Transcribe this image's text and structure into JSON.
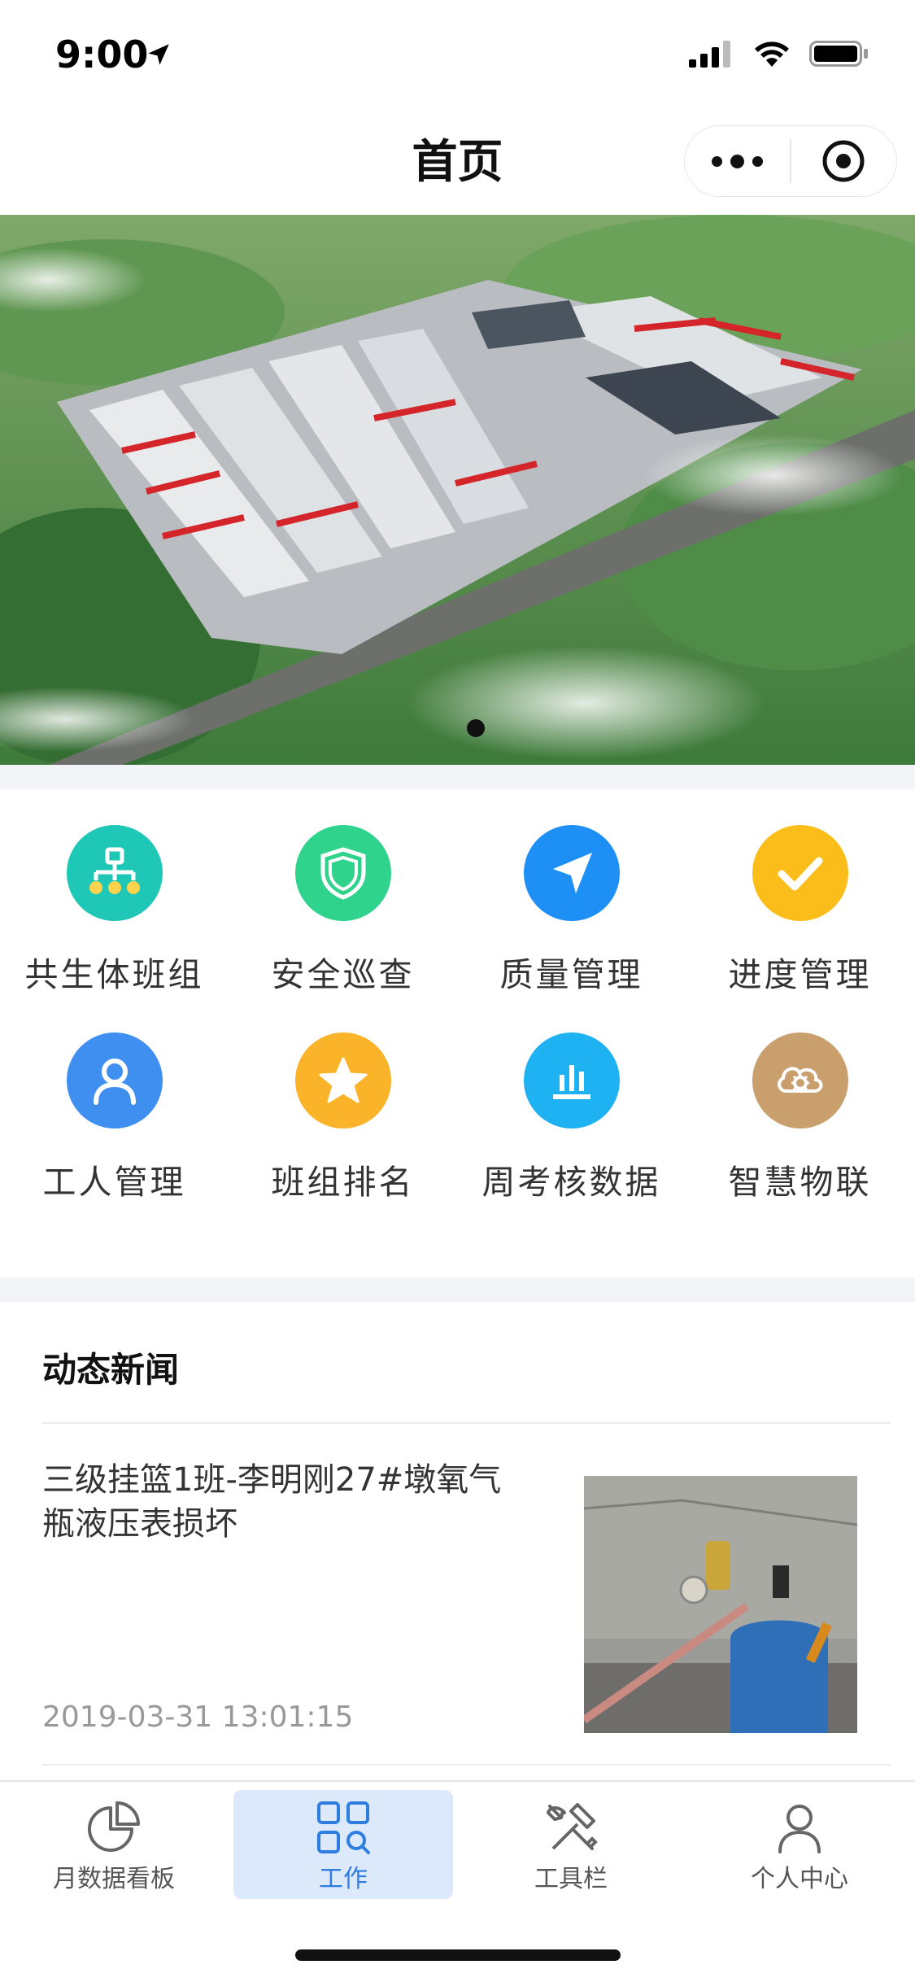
{
  "status_bar": {
    "time": "9:00"
  },
  "nav": {
    "title": "首页"
  },
  "grid": {
    "items": [
      {
        "label": "共生体班组",
        "icon": "org-chart-icon",
        "color": "#1fc7b6"
      },
      {
        "label": "安全巡查",
        "icon": "shield-icon",
        "color": "#2fd38c"
      },
      {
        "label": "质量管理",
        "icon": "send-arrow-icon",
        "color": "#1e8ff5"
      },
      {
        "label": "进度管理",
        "icon": "check-icon",
        "color": "#fbbd1a"
      },
      {
        "label": "工人管理",
        "icon": "person-icon",
        "color": "#3f8ff1"
      },
      {
        "label": "班组排名",
        "icon": "star-icon",
        "color": "#fbb32a"
      },
      {
        "label": "周考核数据",
        "icon": "bar-chart-icon",
        "color": "#1fb2f3"
      },
      {
        "label": "智慧物联",
        "icon": "cloud-gear-icon",
        "color": "#c89f6d"
      }
    ]
  },
  "news": {
    "title": "动态新闻",
    "items": [
      {
        "headline": "三级挂篮1班-李明刚27#墩氧气瓶液压表损坏",
        "time": "2019-03-31 13:01:15"
      }
    ]
  },
  "tabs": [
    {
      "label": "月数据看板",
      "icon": "pie-chart-icon",
      "active": false
    },
    {
      "label": "工作",
      "icon": "work-grid-icon",
      "active": true
    },
    {
      "label": "工具栏",
      "icon": "tools-icon",
      "active": false
    },
    {
      "label": "个人中心",
      "icon": "user-icon",
      "active": false
    }
  ]
}
